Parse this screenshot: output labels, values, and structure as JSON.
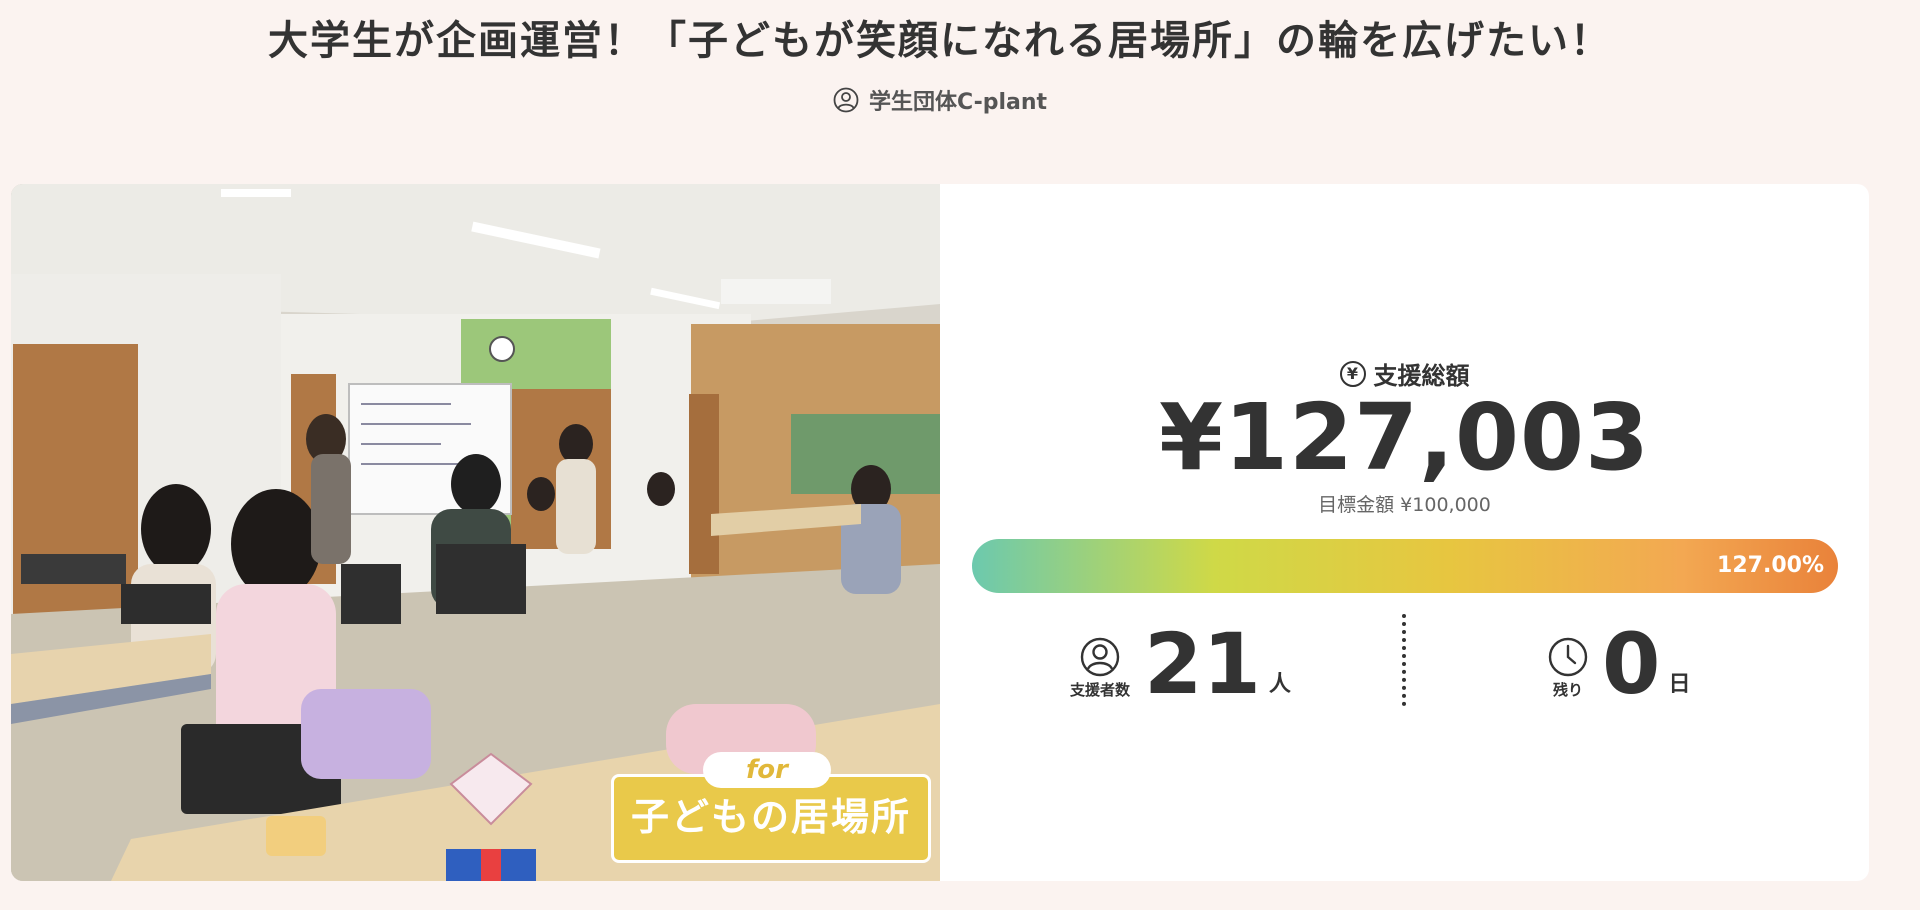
{
  "header": {
    "title": "大学生が企画運営！「子どもが笑顔になれる居場所」の輪を広げたい！",
    "owner": "学生団体C-plant",
    "owner_icon": "user-circle-icon"
  },
  "photo": {
    "badge_for": "for",
    "badge_text": "子どもの居場所"
  },
  "funding": {
    "raised_label": "支援総額",
    "raised_icon_glyph": "¥",
    "amount": "¥127,003",
    "goal": "目標金額 ¥100,000",
    "progress_percent": 127.0,
    "progress_label": "127.00%"
  },
  "stats": {
    "supporters": {
      "caption": "支援者数",
      "value": "21",
      "unit": "人",
      "icon": "user-circle-icon"
    },
    "remaining": {
      "caption": "残り",
      "value": "0",
      "unit": "日",
      "icon": "clock-icon"
    }
  },
  "colors": {
    "background": "#fbf3f0",
    "badge": "#e9c94a",
    "progress_start": "#6cc9ae",
    "progress_end": "#e9823a"
  }
}
